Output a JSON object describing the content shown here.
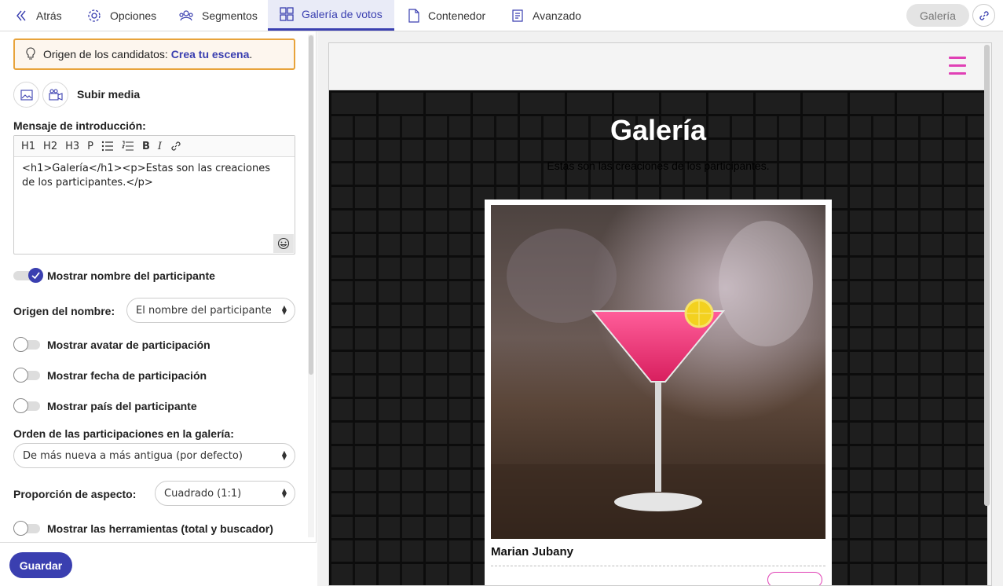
{
  "topbar": {
    "tabs": [
      {
        "label": "Atrás",
        "icon": "chevrons-left-icon"
      },
      {
        "label": "Opciones",
        "icon": "gear-icon"
      },
      {
        "label": "Segmentos",
        "icon": "users-icon"
      },
      {
        "label": "Galería de votos",
        "icon": "grid-icon",
        "active": true
      },
      {
        "label": "Contenedor",
        "icon": "document-icon"
      },
      {
        "label": "Avanzado",
        "icon": "script-icon"
      }
    ],
    "gallery_button": "Galería",
    "link_icon": "link-icon"
  },
  "sidebar": {
    "notice_prefix": "Origen de los candidatos:",
    "notice_link": "Crea tu escena",
    "notice_suffix": ".",
    "upload_label": "Subir media",
    "intro_label": "Mensaje de introducción:",
    "toolbar": [
      "H1",
      "H2",
      "H3",
      "P"
    ],
    "intro_text": "<h1>Galería</h1><p>Estas son las creaciones de los participantes.</p>",
    "show_name": {
      "label": "Mostrar nombre del participante",
      "on": true
    },
    "name_origin_label": "Origen del nombre:",
    "name_origin_value": "El nombre del participante (por defecto)",
    "show_avatar": {
      "label": "Mostrar avatar de participación",
      "on": false
    },
    "show_date": {
      "label": "Mostrar fecha de participación",
      "on": false
    },
    "show_country": {
      "label": "Mostrar país del participante",
      "on": false
    },
    "order_label": "Orden de las participaciones en la galería:",
    "order_value": "De más nueva a más antigua (por defecto)",
    "aspect_label": "Proporción de aspecto:",
    "aspect_value": "Cuadrado (1:1)",
    "show_tools": {
      "label": "Mostrar las herramientas (total y buscador)",
      "on": false
    },
    "save_label": "Guardar"
  },
  "preview": {
    "title": "Galería",
    "subtitle": "Estas son las creaciones de los participantes.",
    "card_name": "Marian Jubany",
    "accent": "#e040b5"
  },
  "colors": {
    "primary": "#3a3fb0",
    "notice_border": "#e8a33b"
  }
}
